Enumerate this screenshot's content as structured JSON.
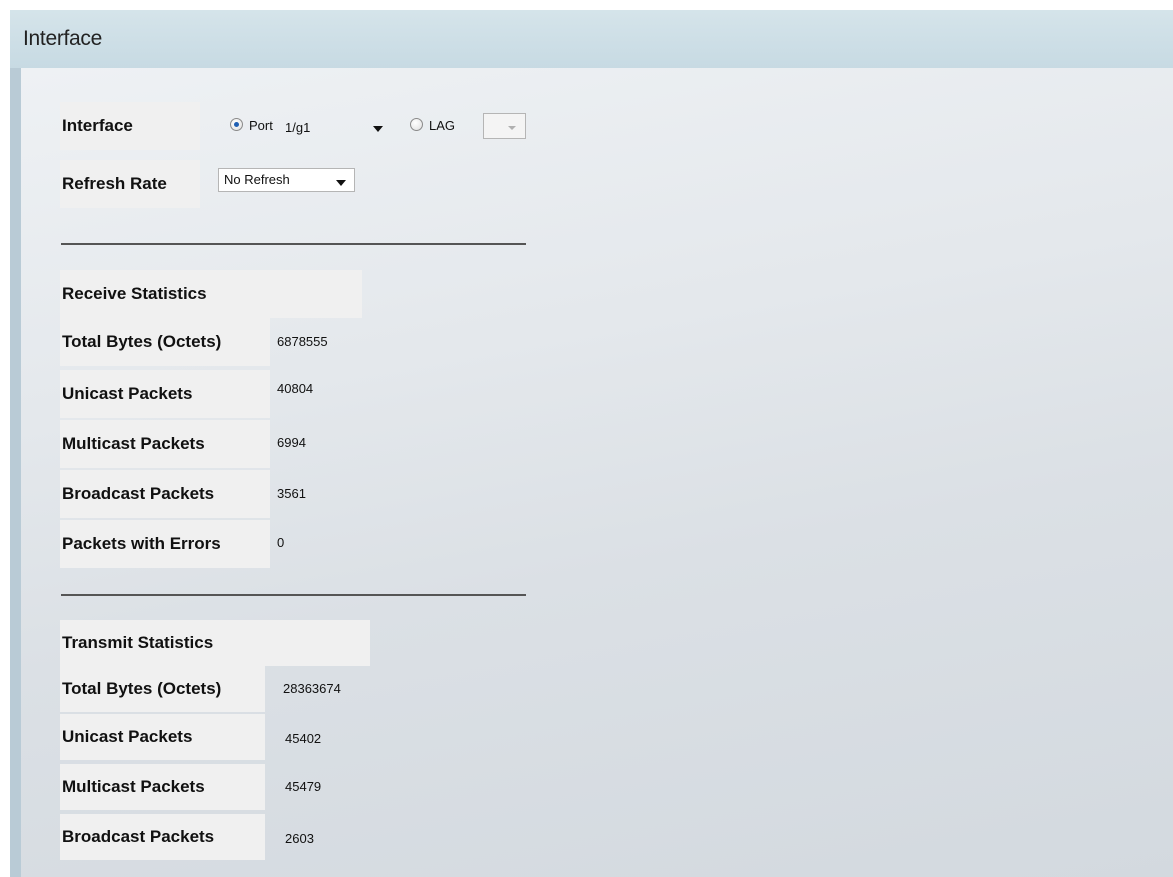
{
  "page": {
    "title": "Interface"
  },
  "filter": {
    "interface_label": "Interface",
    "port_label": "Port",
    "port_value": "1/g1",
    "lag_label": "LAG",
    "lag_value": "",
    "selected": "port",
    "refresh_label": "Refresh Rate",
    "refresh_value": "No Refresh"
  },
  "receive": {
    "heading": "Receive Statistics",
    "rows": [
      {
        "label": "Total Bytes (Octets)",
        "value": "6878555"
      },
      {
        "label": "Unicast Packets",
        "value": "40804"
      },
      {
        "label": "Multicast Packets",
        "value": "6994"
      },
      {
        "label": "Broadcast Packets",
        "value": "3561"
      },
      {
        "label": "Packets with Errors",
        "value": "0"
      }
    ]
  },
  "transmit": {
    "heading": "Transmit Statistics",
    "rows": [
      {
        "label": "Total Bytes (Octets)",
        "value": "28363674"
      },
      {
        "label": "Unicast Packets",
        "value": "45402"
      },
      {
        "label": "Multicast Packets",
        "value": "45479"
      },
      {
        "label": "Broadcast Packets",
        "value": "2603"
      }
    ]
  }
}
